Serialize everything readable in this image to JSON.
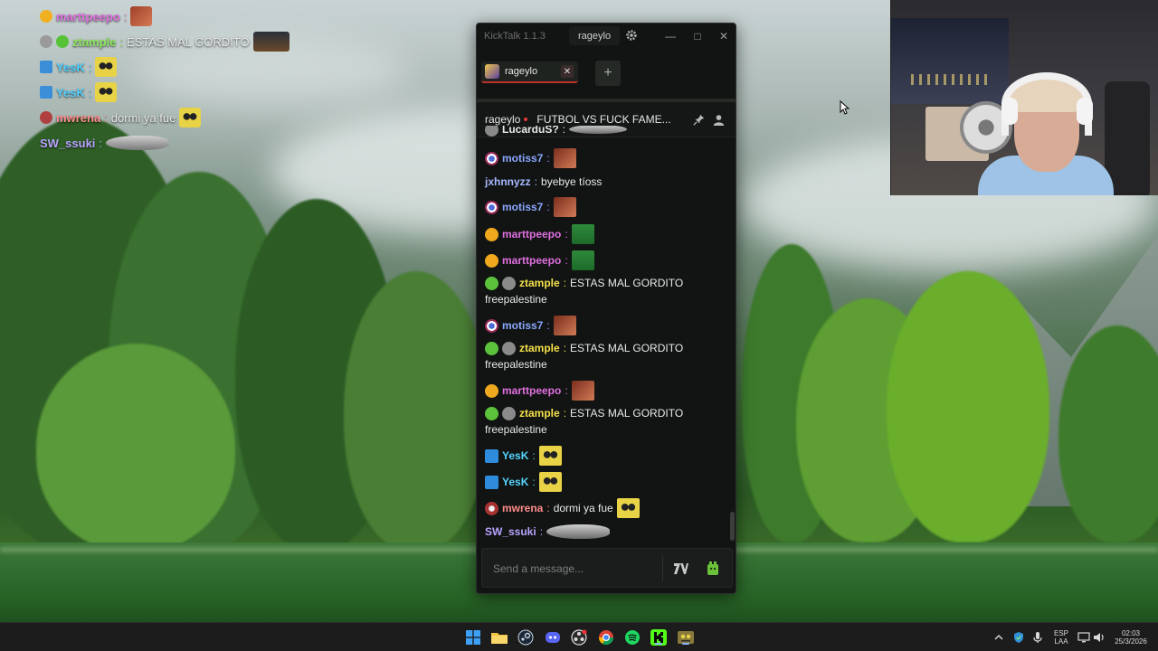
{
  "overlay_chat": [
    {
      "username": "marttpeepo",
      "separator": ":",
      "text": "",
      "name_color": "#e070e0",
      "badge": "crown-badge",
      "emote": "red-face-emote"
    },
    {
      "username": "ztample",
      "separator": ":",
      "text": "ESTAS MAL GORDITO",
      "name_color": "#8be85a",
      "badge": "green-alien-badge",
      "emote": "car-emote"
    },
    {
      "username": "YesK",
      "separator": ":",
      "text": "",
      "name_color": "#4fd0ff",
      "badge": "blue-arrow-badge",
      "emote": "yellow-glasses-emote"
    },
    {
      "username": "YesK",
      "separator": ":",
      "text": "",
      "name_color": "#4fd0ff",
      "badge": "blue-arrow-badge",
      "emote": "yellow-glasses-emote"
    },
    {
      "username": "mwrena",
      "separator": ":",
      "text": "dormi ya fue",
      "name_color": "#ff8c8c",
      "badge": "skull-badge",
      "emote": "yellow-glasses-emote"
    },
    {
      "username": "SW_ssuki",
      "separator": ":",
      "text": "",
      "name_color": "#b9a3ff",
      "badge": "",
      "emote": "sleeping-cat-emote"
    }
  ],
  "window": {
    "title": "KickTalk 1.1.3",
    "user": "rageylo",
    "minimize": "—",
    "maximize": "□",
    "close": "✕"
  },
  "tabs": [
    {
      "label": "rageylo",
      "close": "✕"
    }
  ],
  "add_tab": "+",
  "channel": {
    "name": "rageylo",
    "stream_title": "FUTBOL VS FUCK FAME..."
  },
  "messages": [
    {
      "username": "LucarduS?",
      "separator": ":",
      "text": "",
      "name_color": "#e9e9e9",
      "badges": [
        "gray-badge"
      ],
      "emote": "sleeping-cat-emote",
      "partial": true
    },
    {
      "username": "motiss7",
      "separator": ":",
      "text": "",
      "name_color": "#8aa7ff",
      "badges": [
        "target-badge"
      ],
      "emote": "red-face-emote"
    },
    {
      "username": "jxhnnyzz",
      "separator": ":",
      "text": "byebye tíoss",
      "name_color": "#a8b8ff",
      "badges": [],
      "emote": ""
    },
    {
      "username": "motiss7",
      "separator": ":",
      "text": "",
      "name_color": "#8aa7ff",
      "badges": [
        "target-badge"
      ],
      "emote": "red-face-emote"
    },
    {
      "username": "marttpeepo",
      "separator": ":",
      "text": "",
      "name_color": "#e070e0",
      "badges": [
        "crown-badge"
      ],
      "emote": "frog-emote"
    },
    {
      "username": "marttpeepo",
      "separator": ":",
      "text": "",
      "name_color": "#e070e0",
      "badges": [
        "crown-badge"
      ],
      "emote": "frog-emote"
    },
    {
      "username": "ztample",
      "separator": ":",
      "text": "ESTAS MAL GORDITO",
      "continuation": "freepalestine",
      "name_color": "#f5e04a",
      "badges": [
        "green-alien-badge",
        "gray-badge"
      ],
      "emote": ""
    },
    {
      "username": "motiss7",
      "separator": ":",
      "text": "",
      "name_color": "#8aa7ff",
      "badges": [
        "target-badge"
      ],
      "emote": "red-face-emote"
    },
    {
      "username": "ztample",
      "separator": ":",
      "text": "ESTAS MAL GORDITO",
      "continuation": "freepalestine",
      "name_color": "#f5e04a",
      "badges": [
        "green-alien-badge",
        "gray-badge"
      ],
      "emote": ""
    },
    {
      "username": "marttpeepo",
      "separator": ":",
      "text": "",
      "name_color": "#e070e0",
      "badges": [
        "crown-badge"
      ],
      "emote": "red-face-emote"
    },
    {
      "username": "ztample",
      "separator": ":",
      "text": "ESTAS MAL GORDITO",
      "continuation": "freepalestine",
      "name_color": "#f5e04a",
      "badges": [
        "green-alien-badge",
        "gray-badge"
      ],
      "emote": ""
    },
    {
      "username": "YesK",
      "separator": ":",
      "text": "",
      "name_color": "#56d4ff",
      "badges": [
        "blue-arrow-badge"
      ],
      "emote": "yellow-glasses-emote"
    },
    {
      "username": "YesK",
      "separator": ":",
      "text": "",
      "name_color": "#56d4ff",
      "badges": [
        "blue-arrow-badge"
      ],
      "emote": "yellow-glasses-emote"
    },
    {
      "username": "mwrena",
      "separator": ":",
      "text": "dormi ya fue",
      "name_color": "#ff8c8c",
      "badges": [
        "skull-badge"
      ],
      "emote": "yellow-glasses-emote"
    },
    {
      "username": "SW_ssuki",
      "separator": ":",
      "text": "",
      "name_color": "#b9a3ff",
      "badges": [],
      "emote": "sleeping-cat-emote"
    }
  ],
  "input": {
    "placeholder": "Send a message...",
    "value": ""
  },
  "taskbar": {
    "apps": [
      "windows-start-icon",
      "file-explorer-icon",
      "steam-icon",
      "discord-icon",
      "obs-icon",
      "chrome-icon",
      "spotify-icon",
      "kick-icon",
      "kicktalk-icon"
    ],
    "tray": {
      "language": "ESP",
      "layout": "LAA",
      "time": "02:03",
      "date": "25/3/2026"
    }
  },
  "colors": {
    "accent_red": "#c0302a",
    "kick_green": "#53fc18",
    "window_bg": "#111412"
  }
}
